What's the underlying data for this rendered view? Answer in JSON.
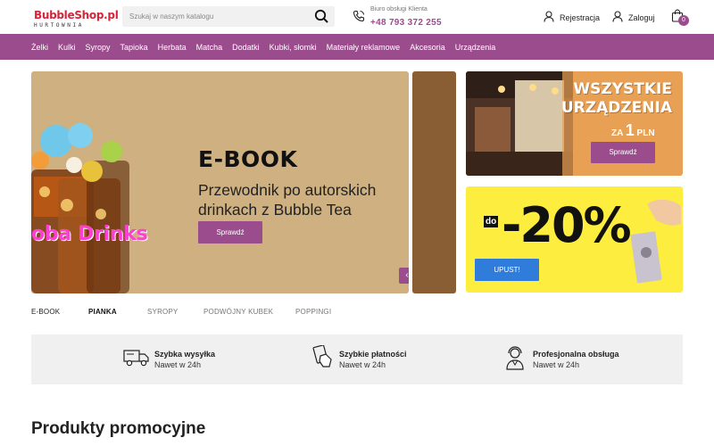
{
  "header": {
    "logo_brand": "BubbleShop.pl",
    "logo_sub": "HURTOWNIA",
    "search_placeholder": "Szukaj w naszym katalogu",
    "contact_label": "Biuro obsługi Klienta",
    "contact_phone": "+48 793 372 255",
    "register_label": "Rejestracja",
    "login_label": "Zaloguj",
    "cart_count": "0"
  },
  "nav": {
    "items": [
      "Żelki",
      "Kulki",
      "Syropy",
      "Tapioka",
      "Herbata",
      "Matcha",
      "Dodatki",
      "Kubki, słomki",
      "Materiały reklamowe",
      "Akcesoria",
      "Urządzenia"
    ]
  },
  "slider": {
    "title": "E-BOOK",
    "subtitle": "Przewodnik po autorskich drinkach z Bubble Tea",
    "button": "Sprawdź",
    "image_text": "oba Drinks",
    "prev_arrow": "‹",
    "next_arrow": "›"
  },
  "promo1": {
    "title_line1": "WSZYSTKIE",
    "title_line2": "URZĄDZENIA",
    "price_prefix": "ZA",
    "price_value": "1",
    "price_suffix": "PLN",
    "button": "Sprawdź"
  },
  "promo2": {
    "prefix": "do",
    "discount": "-20%",
    "button": "UPUST!"
  },
  "tabs": [
    "E-BOOK",
    "PIANKA",
    "SYROPY",
    "PODWÓJNY KUBEK",
    "POPPINGI"
  ],
  "features": [
    {
      "icon": "truck-icon",
      "title": "Szybka wysyłka",
      "subtitle": "Nawet w 24h"
    },
    {
      "icon": "payment-icon",
      "title": "Szybkie płatności",
      "subtitle": "Nawet w 24h"
    },
    {
      "icon": "support-agent-icon",
      "title": "Profesjonalna obsługa",
      "subtitle": "Nawet w 24h"
    }
  ],
  "section_title": "Produkty promocyjne",
  "colors": {
    "brand": "#9b4c8c",
    "logo_red": "#d6243a",
    "promo_orange": "#e8a054",
    "promo_yellow": "#fced3e",
    "promo_blue": "#2f7cdb"
  }
}
